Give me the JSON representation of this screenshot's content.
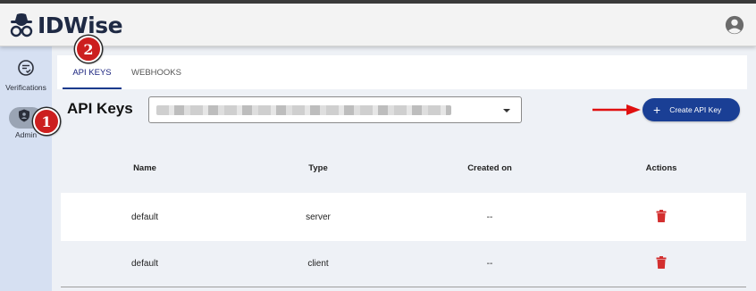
{
  "app": {
    "logo_text": "IDWise"
  },
  "sidebar": {
    "items": [
      {
        "label": "Verifications",
        "icon": "verifications-icon"
      },
      {
        "label": "Admin",
        "icon": "shield-icon"
      }
    ]
  },
  "tabs": [
    {
      "label": "API KEYS",
      "active": true
    },
    {
      "label": "WEBHOOKS",
      "active": false
    }
  ],
  "page": {
    "title": "API Keys",
    "create_button": "Create API Key",
    "create_icon": "+",
    "accent_color": "#1a3f95",
    "arrow_color": "#e01010"
  },
  "table": {
    "headers": [
      "Name",
      "Type",
      "Created on",
      "Actions"
    ],
    "rows": [
      {
        "name": "default",
        "type": "server",
        "created": "--"
      },
      {
        "name": "default",
        "type": "client",
        "created": "--"
      }
    ],
    "delete_icon_color": "#d32f2f"
  },
  "callouts": [
    "1",
    "2"
  ]
}
